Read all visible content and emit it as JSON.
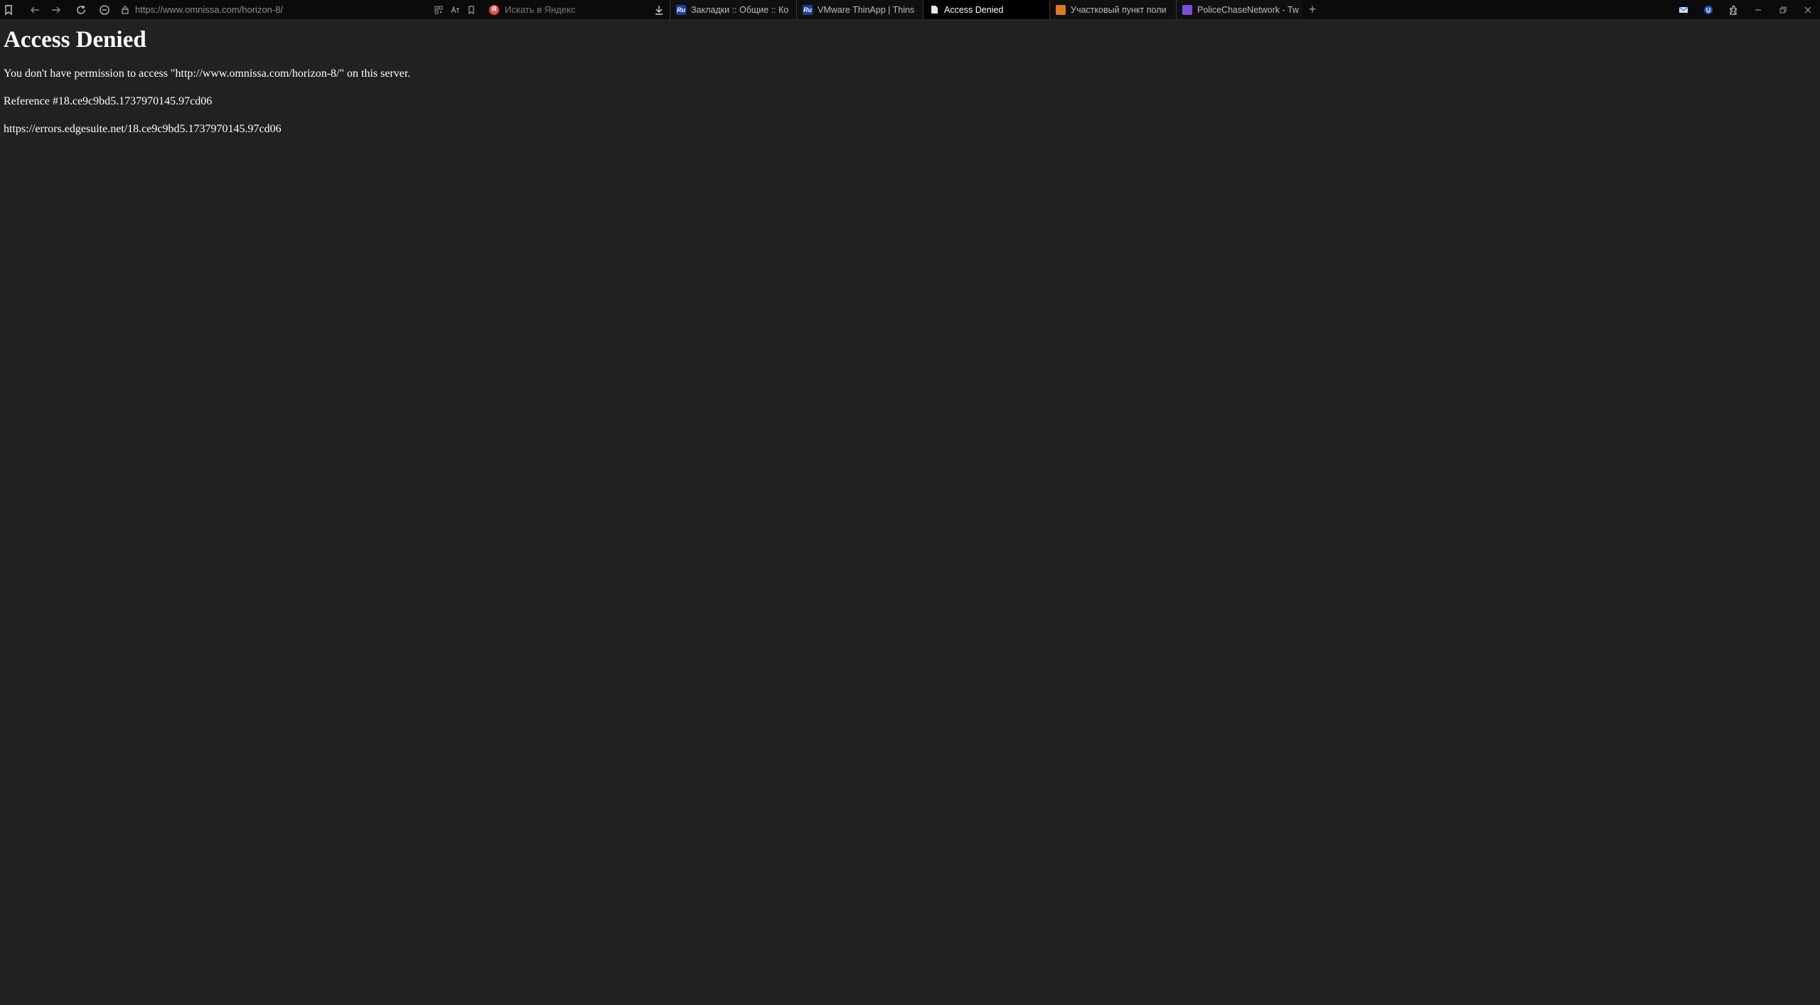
{
  "browser": {
    "url": "https://www.omnissa.com/horizon-8/",
    "search_placeholder": "Искать в Яндекс",
    "search_logo": "Я",
    "tabs": [
      {
        "label": "Закладки :: Общие :: Ко",
        "favicon": "Ru",
        "active": false
      },
      {
        "label": "VMware ThinApp | Thins",
        "favicon": "Ru",
        "active": false
      },
      {
        "label": "Access Denied",
        "favicon": "",
        "active": true
      },
      {
        "label": "Участковый пункт поли",
        "favicon": "",
        "active": false
      },
      {
        "label": "PoliceChaseNetwork - Tw",
        "favicon": "",
        "active": false
      }
    ],
    "new_tab": "+"
  },
  "page": {
    "heading": "Access Denied",
    "message": "You don't have permission to access \"http://www.omnissa.com/horizon-8/\" on this server.",
    "reference": "Reference #18.ce9c9bd5.1737970145.97cd06",
    "error_url": "https://errors.edgesuite.net/18.ce9c9bd5.1737970145.97cd06"
  },
  "colors": {
    "page_background": "#212121",
    "toolbar_background": "#0b0b0b",
    "text": "#ffffff"
  }
}
